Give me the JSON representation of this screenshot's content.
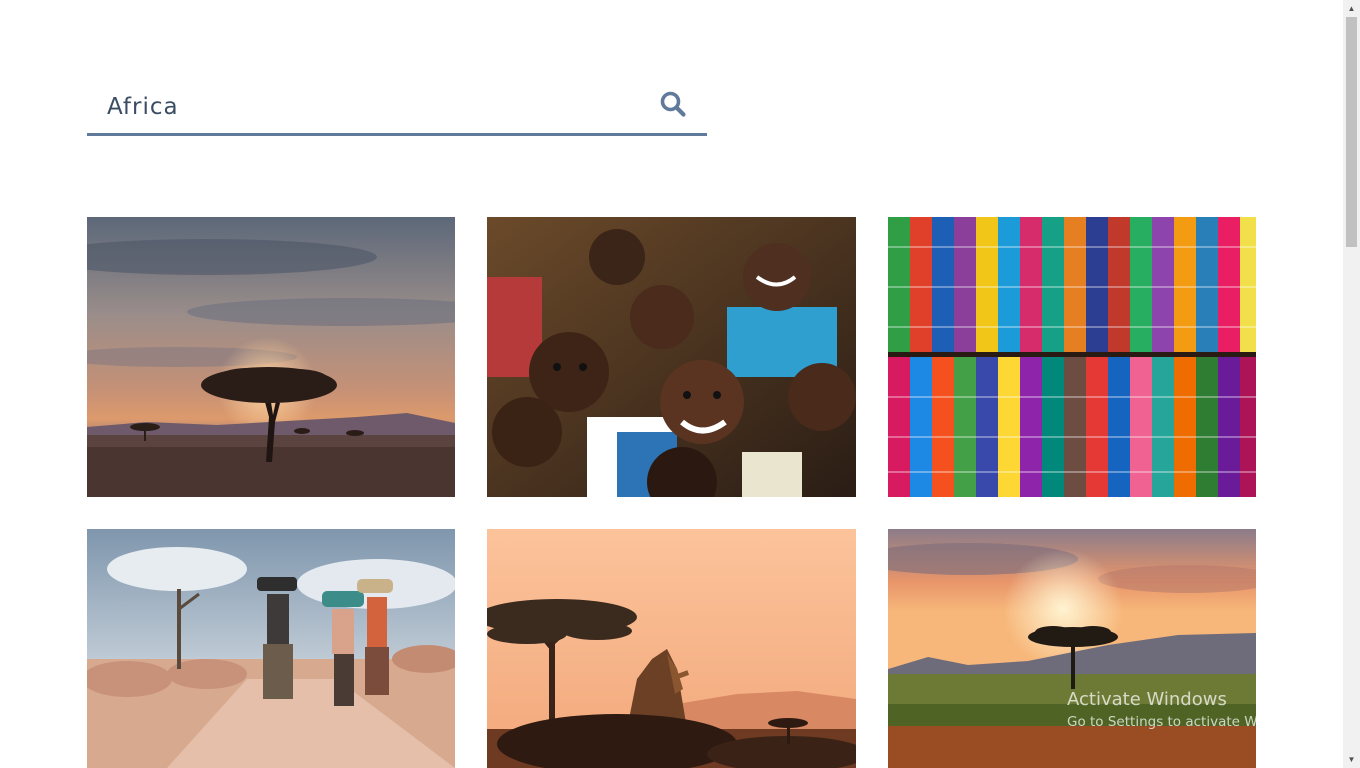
{
  "search": {
    "value": "Africa",
    "button_icon": "search-icon",
    "accent_color": "#5f7a9a"
  },
  "gallery": {
    "images": [
      {
        "subject": "acacia-tree-sunset"
      },
      {
        "subject": "smiling-children"
      },
      {
        "subject": "colorful-fabric-rolls"
      },
      {
        "subject": "women-carrying-basins"
      },
      {
        "subject": "giraffe-savanna"
      },
      {
        "subject": "acacia-sunset-field"
      }
    ]
  },
  "watermark": {
    "title": "Activate Windows",
    "subtitle": "Go to Settings to activate Windows."
  },
  "scrollbar": {
    "up_icon": "arrow-up-icon",
    "down_icon": "arrow-down-icon"
  }
}
